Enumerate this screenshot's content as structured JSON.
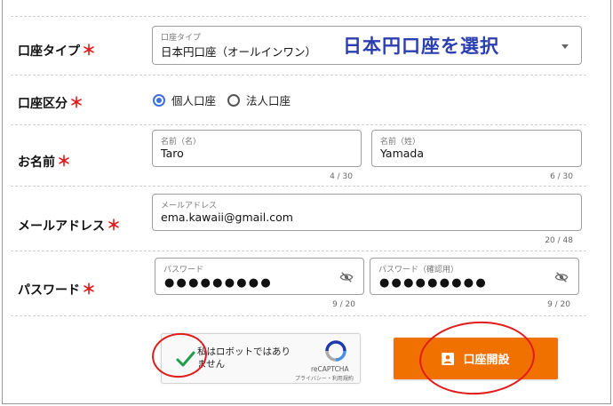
{
  "form": {
    "account_type": {
      "label": "口座タイプ",
      "required_mark": "＊",
      "select_label": "口座タイプ",
      "select_value": "日本円口座（オールインワン）",
      "annotation": "日本円口座を選択"
    },
    "account_category": {
      "label": "口座区分",
      "required_mark": "＊",
      "options": [
        {
          "label": "個人口座",
          "checked": true
        },
        {
          "label": "法人口座",
          "checked": false
        }
      ]
    },
    "name": {
      "label": "お名前",
      "required_mark": "＊",
      "first": {
        "label": "名前（名）",
        "value": "Taro",
        "counter": "4 / 30"
      },
      "last": {
        "label": "名前（姓）",
        "value": "Yamada",
        "counter": "6 / 30"
      }
    },
    "email": {
      "label": "メールアドレス",
      "required_mark": "＊",
      "field_label": "メールアドレス",
      "value": "ema.kawaii@gmail.com",
      "counter": "20 / 48"
    },
    "password": {
      "label": "パスワード",
      "required_mark": "＊",
      "field": {
        "label": "パスワード",
        "value": "●●●●●●●●●",
        "counter": "9 / 20"
      },
      "confirm": {
        "label": "パスワード（確認用）",
        "value": "●●●●●●●●●",
        "counter": "9 / 20"
      }
    },
    "recaptcha": {
      "text": "私はロボットではありません",
      "brand": "reCAPTCHA",
      "links": "プライバシー・利用規約",
      "checked": true
    },
    "submit_label": "口座開設"
  },
  "colors": {
    "accent_orange": "#f07000",
    "annotation_red": "#e21b1b",
    "annotation_blue": "#2b3fb0",
    "radio_blue": "#3f6fd8",
    "required_red": "#e01919"
  }
}
